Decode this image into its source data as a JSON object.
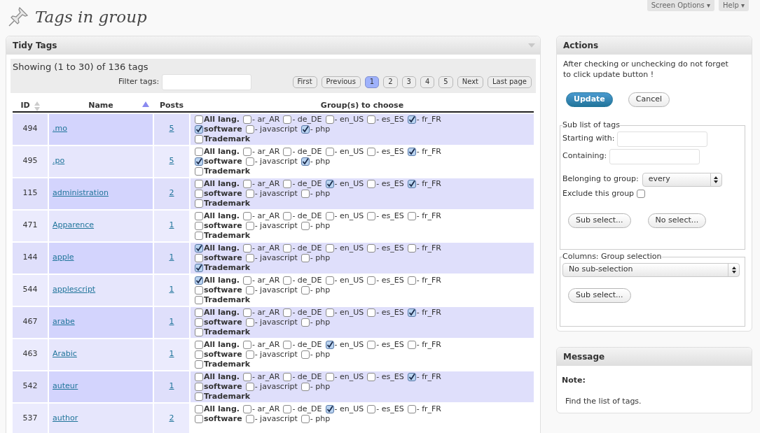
{
  "page": {
    "title": "Tags in group",
    "top_tabs": [
      "Screen Options ▾",
      "Help ▾"
    ]
  },
  "tidy_tags": {
    "title": "Tidy Tags",
    "summary": "Showing (1 to 30) of 136 tags",
    "filter_label": "Filter tags:",
    "pagination": [
      {
        "label": "First",
        "selected": false
      },
      {
        "label": "Previous",
        "selected": false
      },
      {
        "label": "1",
        "selected": true
      },
      {
        "label": "2",
        "selected": false
      },
      {
        "label": "3",
        "selected": false
      },
      {
        "label": "4",
        "selected": false
      },
      {
        "label": "5",
        "selected": false
      },
      {
        "label": "Next",
        "selected": false
      },
      {
        "label": "Last page",
        "selected": false
      }
    ],
    "columns": [
      "ID",
      "Name",
      "Posts",
      "Group(s) to choose"
    ],
    "rows": [
      {
        "id": "494",
        "name": ".mo",
        "posts": "5",
        "lines": [
          [
            {
              "label": "All lang.",
              "kind": "group",
              "checked": false
            },
            {
              "label": "- ar_AR",
              "kind": "lang",
              "checked": false
            },
            {
              "label": "- de_DE",
              "kind": "lang",
              "checked": false
            },
            {
              "label": "- en_US",
              "kind": "lang",
              "checked": false
            },
            {
              "label": "- es_ES",
              "kind": "lang",
              "checked": false
            },
            {
              "label": "- fr_FR",
              "kind": "lang",
              "checked": true
            }
          ],
          [
            {
              "label": "software",
              "kind": "group",
              "checked": true
            },
            {
              "label": "- javascript",
              "kind": "lang",
              "checked": false
            },
            {
              "label": "- php",
              "kind": "lang",
              "checked": true
            }
          ],
          [
            {
              "label": "Trademark",
              "kind": "group",
              "checked": false
            }
          ]
        ]
      },
      {
        "id": "495",
        "name": ".po",
        "posts": "5",
        "lines": [
          [
            {
              "label": "All lang.",
              "kind": "group",
              "checked": false
            },
            {
              "label": "- ar_AR",
              "kind": "lang",
              "checked": false
            },
            {
              "label": "- de_DE",
              "kind": "lang",
              "checked": false
            },
            {
              "label": "- en_US",
              "kind": "lang",
              "checked": false
            },
            {
              "label": "- es_ES",
              "kind": "lang",
              "checked": false
            },
            {
              "label": "- fr_FR",
              "kind": "lang",
              "checked": true
            }
          ],
          [
            {
              "label": "software",
              "kind": "group",
              "checked": true
            },
            {
              "label": "- javascript",
              "kind": "lang",
              "checked": false
            },
            {
              "label": "- php",
              "kind": "lang",
              "checked": true
            }
          ],
          [
            {
              "label": "Trademark",
              "kind": "group",
              "checked": false
            }
          ]
        ]
      },
      {
        "id": "115",
        "name": "administration",
        "posts": "2",
        "lines": [
          [
            {
              "label": "All lang.",
              "kind": "group",
              "checked": false
            },
            {
              "label": "- ar_AR",
              "kind": "lang",
              "checked": false
            },
            {
              "label": "- de_DE",
              "kind": "lang",
              "checked": false
            },
            {
              "label": "- en_US",
              "kind": "lang",
              "checked": true
            },
            {
              "label": "- es_ES",
              "kind": "lang",
              "checked": false
            },
            {
              "label": "- fr_FR",
              "kind": "lang",
              "checked": true
            }
          ],
          [
            {
              "label": "software",
              "kind": "group",
              "checked": false
            },
            {
              "label": "- javascript",
              "kind": "lang",
              "checked": false
            },
            {
              "label": "- php",
              "kind": "lang",
              "checked": false
            }
          ],
          [
            {
              "label": "Trademark",
              "kind": "group",
              "checked": false
            }
          ]
        ]
      },
      {
        "id": "471",
        "name": "Apparence",
        "posts": "1",
        "lines": [
          [
            {
              "label": "All lang.",
              "kind": "group",
              "checked": false
            },
            {
              "label": "- ar_AR",
              "kind": "lang",
              "checked": false
            },
            {
              "label": "- de_DE",
              "kind": "lang",
              "checked": false
            },
            {
              "label": "- en_US",
              "kind": "lang",
              "checked": false
            },
            {
              "label": "- es_ES",
              "kind": "lang",
              "checked": false
            },
            {
              "label": "- fr_FR",
              "kind": "lang",
              "checked": false
            }
          ],
          [
            {
              "label": "software",
              "kind": "group",
              "checked": false
            },
            {
              "label": "- javascript",
              "kind": "lang",
              "checked": false
            },
            {
              "label": "- php",
              "kind": "lang",
              "checked": false
            }
          ],
          [
            {
              "label": "Trademark",
              "kind": "group",
              "checked": false
            }
          ]
        ]
      },
      {
        "id": "144",
        "name": "apple",
        "posts": "1",
        "lines": [
          [
            {
              "label": "All lang.",
              "kind": "group",
              "checked": true
            },
            {
              "label": "- ar_AR",
              "kind": "lang",
              "checked": false
            },
            {
              "label": "- de_DE",
              "kind": "lang",
              "checked": false
            },
            {
              "label": "- en_US",
              "kind": "lang",
              "checked": false
            },
            {
              "label": "- es_ES",
              "kind": "lang",
              "checked": false
            },
            {
              "label": "- fr_FR",
              "kind": "lang",
              "checked": false
            }
          ],
          [
            {
              "label": "software",
              "kind": "group",
              "checked": false
            },
            {
              "label": "- javascript",
              "kind": "lang",
              "checked": false
            },
            {
              "label": "- php",
              "kind": "lang",
              "checked": false
            }
          ],
          [
            {
              "label": "Trademark",
              "kind": "group",
              "checked": true
            }
          ]
        ]
      },
      {
        "id": "544",
        "name": "applescript",
        "posts": "1",
        "lines": [
          [
            {
              "label": "All lang.",
              "kind": "group",
              "checked": true
            },
            {
              "label": "- ar_AR",
              "kind": "lang",
              "checked": false
            },
            {
              "label": "- de_DE",
              "kind": "lang",
              "checked": false
            },
            {
              "label": "- en_US",
              "kind": "lang",
              "checked": false
            },
            {
              "label": "- es_ES",
              "kind": "lang",
              "checked": false
            },
            {
              "label": "- fr_FR",
              "kind": "lang",
              "checked": false
            }
          ],
          [
            {
              "label": "software",
              "kind": "group",
              "checked": false
            },
            {
              "label": "- javascript",
              "kind": "lang",
              "checked": false
            },
            {
              "label": "- php",
              "kind": "lang",
              "checked": false
            }
          ],
          [
            {
              "label": "Trademark",
              "kind": "group",
              "checked": false
            }
          ]
        ]
      },
      {
        "id": "467",
        "name": "arabe",
        "posts": "1",
        "lines": [
          [
            {
              "label": "All lang.",
              "kind": "group",
              "checked": false
            },
            {
              "label": "- ar_AR",
              "kind": "lang",
              "checked": false
            },
            {
              "label": "- de_DE",
              "kind": "lang",
              "checked": false
            },
            {
              "label": "- en_US",
              "kind": "lang",
              "checked": false
            },
            {
              "label": "- es_ES",
              "kind": "lang",
              "checked": false
            },
            {
              "label": "- fr_FR",
              "kind": "lang",
              "checked": true
            }
          ],
          [
            {
              "label": "software",
              "kind": "group",
              "checked": false
            },
            {
              "label": "- javascript",
              "kind": "lang",
              "checked": false
            },
            {
              "label": "- php",
              "kind": "lang",
              "checked": false
            }
          ],
          [
            {
              "label": "Trademark",
              "kind": "group",
              "checked": false
            }
          ]
        ]
      },
      {
        "id": "463",
        "name": "Arabic",
        "posts": "1",
        "lines": [
          [
            {
              "label": "All lang.",
              "kind": "group",
              "checked": false
            },
            {
              "label": "- ar_AR",
              "kind": "lang",
              "checked": false
            },
            {
              "label": "- de_DE",
              "kind": "lang",
              "checked": false
            },
            {
              "label": "- en_US",
              "kind": "lang",
              "checked": true
            },
            {
              "label": "- es_ES",
              "kind": "lang",
              "checked": false
            },
            {
              "label": "- fr_FR",
              "kind": "lang",
              "checked": false
            }
          ],
          [
            {
              "label": "software",
              "kind": "group",
              "checked": false
            },
            {
              "label": "- javascript",
              "kind": "lang",
              "checked": false
            },
            {
              "label": "- php",
              "kind": "lang",
              "checked": false
            }
          ],
          [
            {
              "label": "Trademark",
              "kind": "group",
              "checked": false
            }
          ]
        ]
      },
      {
        "id": "542",
        "name": "auteur",
        "posts": "1",
        "lines": [
          [
            {
              "label": "All lang.",
              "kind": "group",
              "checked": false
            },
            {
              "label": "- ar_AR",
              "kind": "lang",
              "checked": false
            },
            {
              "label": "- de_DE",
              "kind": "lang",
              "checked": false
            },
            {
              "label": "- en_US",
              "kind": "lang",
              "checked": false
            },
            {
              "label": "- es_ES",
              "kind": "lang",
              "checked": false
            },
            {
              "label": "- fr_FR",
              "kind": "lang",
              "checked": true
            }
          ],
          [
            {
              "label": "software",
              "kind": "group",
              "checked": false
            },
            {
              "label": "- javascript",
              "kind": "lang",
              "checked": false
            },
            {
              "label": "- php",
              "kind": "lang",
              "checked": false
            }
          ],
          [
            {
              "label": "Trademark",
              "kind": "group",
              "checked": false
            }
          ]
        ]
      },
      {
        "id": "537",
        "name": "author",
        "posts": "2",
        "lines": [
          [
            {
              "label": "All lang.",
              "kind": "group",
              "checked": false
            },
            {
              "label": "- ar_AR",
              "kind": "lang",
              "checked": false
            },
            {
              "label": "- de_DE",
              "kind": "lang",
              "checked": false
            },
            {
              "label": "- en_US",
              "kind": "lang",
              "checked": true
            },
            {
              "label": "- es_ES",
              "kind": "lang",
              "checked": false
            },
            {
              "label": "- fr_FR",
              "kind": "lang",
              "checked": false
            }
          ],
          [
            {
              "label": "software",
              "kind": "group",
              "checked": false
            },
            {
              "label": "- javascript",
              "kind": "lang",
              "checked": false
            },
            {
              "label": "- php",
              "kind": "lang",
              "checked": false
            }
          ]
        ]
      }
    ]
  },
  "actions": {
    "title": "Actions",
    "note": "After checking or unchecking do not forget to click update button !",
    "buttons": [
      {
        "label": "Update",
        "kind": "primary"
      },
      {
        "label": "Cancel",
        "kind": "secondary"
      }
    ],
    "sub_list": {
      "legend": "Sub list of tags",
      "starting_with": "Starting with:",
      "containing": "Containing:",
      "group_label": "Belonging to group:",
      "group_value": "every",
      "exclude_label": "Exclude this group",
      "exclude": false,
      "buttons": [
        "Sub select...",
        "No select..."
      ]
    },
    "columns_group": {
      "legend": "Columns: Group selection",
      "value": "No sub-selection",
      "button": "Sub select..."
    }
  },
  "message": {
    "title": "Message",
    "note_label": "Note:",
    "text": "Find the list of tags."
  }
}
